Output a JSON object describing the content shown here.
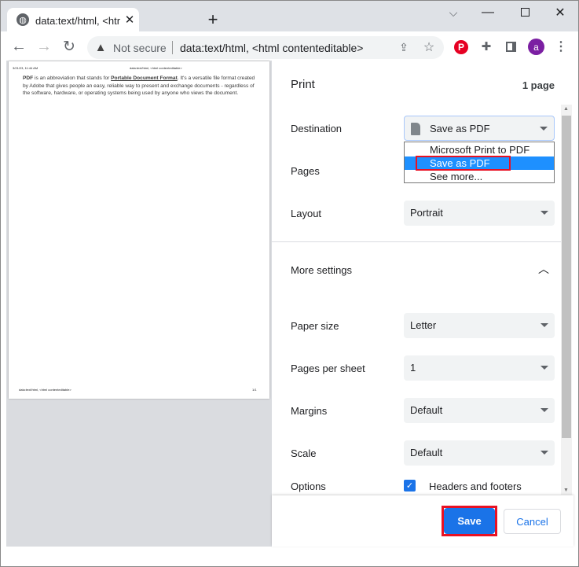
{
  "browser": {
    "tab_title": "data:text/html, <html contentedi",
    "security_label": "Not secure",
    "url": "data:text/html, <html contenteditable>",
    "profile_initial": "a"
  },
  "preview": {
    "header_date": "3/21/23, 11:44 AM",
    "header_title": "data:text/html, <html contenteditable>",
    "body_bold": "PDF",
    "body_1": " is an abbreviation that stands for ",
    "body_link": "Portable Document Format",
    "body_2": ". It's a versatile file format created by Adobe that gives people an easy, reliable way to present and exchange documents - regardless of the software, hardware, or operating systems being used by anyone who views the document.",
    "footer_url": "data:text/html, <html contenteditable>",
    "footer_page": "1/1"
  },
  "print": {
    "title": "Print",
    "page_count": "1 page",
    "destination": {
      "label": "Destination",
      "value": "Save as PDF",
      "options": [
        "Microsoft Print to PDF",
        "Save as PDF",
        "See more..."
      ],
      "selected_index": 1
    },
    "pages": {
      "label": "Pages"
    },
    "layout": {
      "label": "Layout",
      "value": "Portrait"
    },
    "more_settings": "More settings",
    "paper_size": {
      "label": "Paper size",
      "value": "Letter"
    },
    "pages_per_sheet": {
      "label": "Pages per sheet",
      "value": "1"
    },
    "margins": {
      "label": "Margins",
      "value": "Default"
    },
    "scale": {
      "label": "Scale",
      "value": "Default"
    },
    "options": {
      "label": "Options",
      "headers_footers": "Headers and footers",
      "checked": true
    },
    "save": "Save",
    "cancel": "Cancel"
  },
  "colors": {
    "accent": "#1a73e8",
    "highlight": "#e81123",
    "selected": "#1e90ff",
    "pinterest": "#e60023",
    "avatar": "#7b1fa2"
  }
}
